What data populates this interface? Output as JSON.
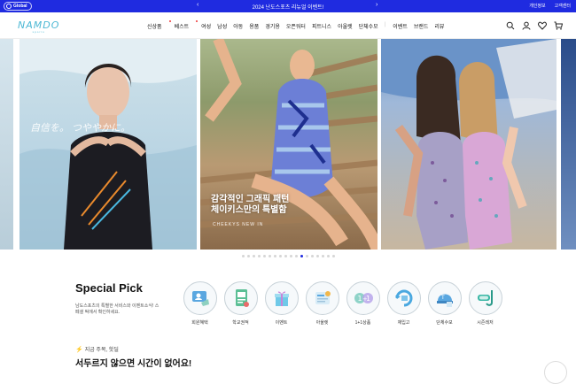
{
  "topbar": {
    "global_label": "Global",
    "promo_text": "2024 난도스포츠 리뉴얼 이벤트!",
    "prev_arrow": "‹",
    "next_arrow": "›",
    "links": [
      "개인정보",
      "고객센터"
    ]
  },
  "header": {
    "logo_text": "NAMDO",
    "logo_sub": "sports",
    "nav": [
      "신상품",
      "베스트",
      "여성",
      "남성",
      "아동",
      "용품",
      "경기용",
      "오픈워터",
      "피트니스",
      "아울렛",
      "단체수모",
      "이벤트",
      "브랜드",
      "리뷰"
    ],
    "icons": [
      "search-icon",
      "user-icon",
      "heart-icon",
      "cart-icon"
    ]
  },
  "hero": {
    "caption_line1": "감각적인 그래픽 패턴",
    "caption_line2": "체이키스만의 특별함",
    "caption_brand": "CHEEKYS NEW IN",
    "slide1_script": "自信を。 つややかに。",
    "active_dot_index": 11,
    "dot_count": 18
  },
  "special": {
    "title": "Special Pick",
    "desc": "남도스포츠의 특별한 서비스와 이벤트소식! 스페셜 픽에서 확인하세요.",
    "items": [
      {
        "label": "회원혜택",
        "icon": "member-card-icon"
      },
      {
        "label": "학교권적",
        "icon": "school-badge-icon"
      },
      {
        "label": "이벤트",
        "icon": "gift-box-icon"
      },
      {
        "label": "아울렛",
        "icon": "sale-tag-icon"
      },
      {
        "label": "1+1상품",
        "icon": "one-plus-one-icon"
      },
      {
        "label": "재입고",
        "icon": "restock-icon"
      },
      {
        "label": "단체수모",
        "icon": "swim-cap-icon"
      },
      {
        "label": "시즌레저",
        "icon": "snorkel-icon"
      }
    ]
  },
  "trend": {
    "eyebrow": "지금 주목, 핫딜",
    "title": "서두르지 않으면 시간이 없어요!"
  },
  "colors": {
    "brand_blue": "#1f2be0",
    "logo_teal": "#4cb8d4",
    "bolt": "#f2a313"
  }
}
